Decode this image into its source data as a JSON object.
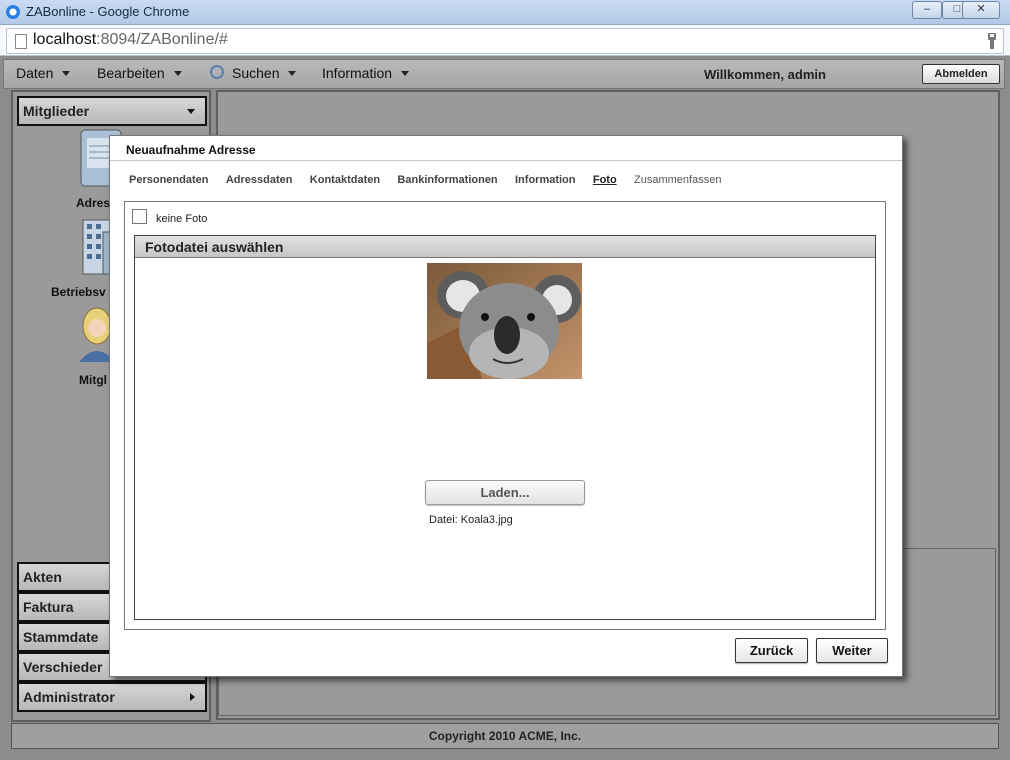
{
  "window": {
    "title": "ZABonline - Google Chrome",
    "controls": [
      "minimize-icon",
      "maximize-icon",
      "close-icon"
    ]
  },
  "browser": {
    "url_host": "localhost",
    "url_rest": ":8094/ZABonline/#"
  },
  "menubar": {
    "items": [
      "Daten",
      "Bearbeiten",
      "Suchen",
      "Information"
    ],
    "welcome": "Willkommen, admin",
    "logout": "Abmelden"
  },
  "sidebar": {
    "members_header": "Mitglieder",
    "nav_items": [
      "Adres",
      "Betriebsv",
      "Mitgl"
    ],
    "sections": [
      "Akten",
      "Faktura",
      "Stammdate",
      "Verschieder",
      "Administrator"
    ]
  },
  "footer": {
    "copyright": "Copyright 2010 ACME, Inc."
  },
  "modal": {
    "title": "Neuaufnahme Adresse",
    "tabs": [
      "Personendaten",
      "Adressdaten",
      "Kontaktdaten",
      "Bankinformationen",
      "Information",
      "Foto",
      "Zusammenfassen"
    ],
    "active_tab": "Foto",
    "no_photo_label": "keine Foto",
    "panel_title": "Fotodatei auswählen",
    "load_button": "Laden...",
    "file_label": "Datei: Koala3.jpg",
    "back_button": "Zurück",
    "next_button": "Weiter"
  },
  "colors": {
    "app_bg": "#8c8c8c",
    "panel_bg": "#9a9a9a",
    "titlebar": "#b1c9e8"
  }
}
